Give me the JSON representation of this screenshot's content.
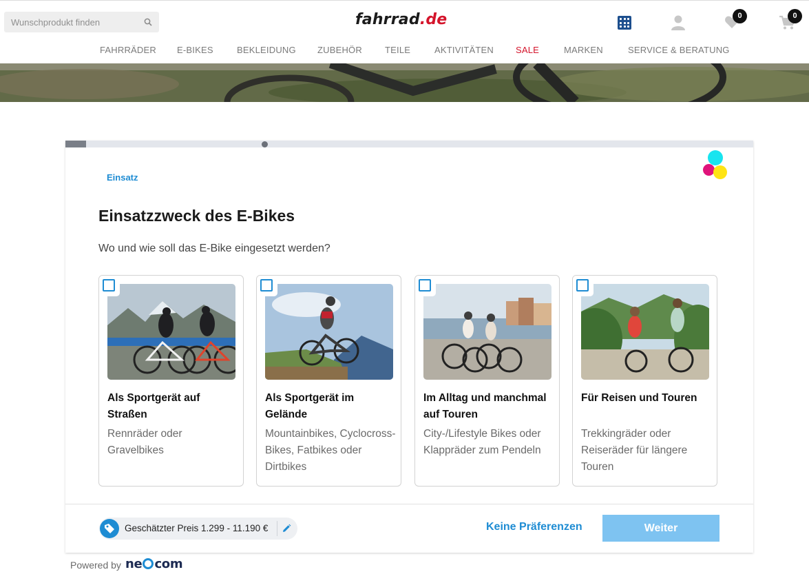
{
  "header": {
    "search_placeholder": "Wunschprodukt finden",
    "logo_main": "fahrrad",
    "logo_dot": ".de",
    "wishlist_count": "0",
    "cart_count": "0"
  },
  "nav": {
    "items": [
      {
        "label": "FAHRRÄDER"
      },
      {
        "label": "E-BIKES"
      },
      {
        "label": "BEKLEIDUNG"
      },
      {
        "label": "ZUBEHÖR"
      },
      {
        "label": "TEILE"
      },
      {
        "label": "AKTIVITÄTEN"
      },
      {
        "label": "SALE"
      },
      {
        "label": "MARKEN"
      },
      {
        "label": "SERVICE & BERATUNG"
      }
    ]
  },
  "wizard": {
    "step_label": "Einsatz",
    "title": "Einsatzzweck des E-Bikes",
    "subtitle": "Wo und wie soll das E-Bike eingesetzt werden?",
    "options": [
      {
        "title": "Als Sportgerät auf Straßen",
        "description": "Rennräder oder Gravelbikes",
        "checked": false
      },
      {
        "title": "Als Sportgerät im Gelände",
        "description": "Mountainbikes, Cyclocross-Bikes, Fatbikes oder Dirtbikes",
        "checked": false
      },
      {
        "title": "Im Alltag und manchmal auf Touren",
        "description": "City-/Lifestyle Bikes oder Klappräder zum Pendeln",
        "checked": false
      },
      {
        "title": "Für Reisen und Touren",
        "description": "Trekkingräder oder Reiseräder für längere Touren",
        "checked": false
      }
    ],
    "price_text": "Geschätzter Preis 1.299 - 11.190 €",
    "no_preference_label": "Keine Präferenzen",
    "next_label": "Weiter"
  },
  "footer": {
    "powered_by": "Powered by",
    "brand": "ne com"
  },
  "colors": {
    "accent": "#1e8cd3",
    "sale": "#d4142b",
    "next_button": "#7ec3f1"
  }
}
